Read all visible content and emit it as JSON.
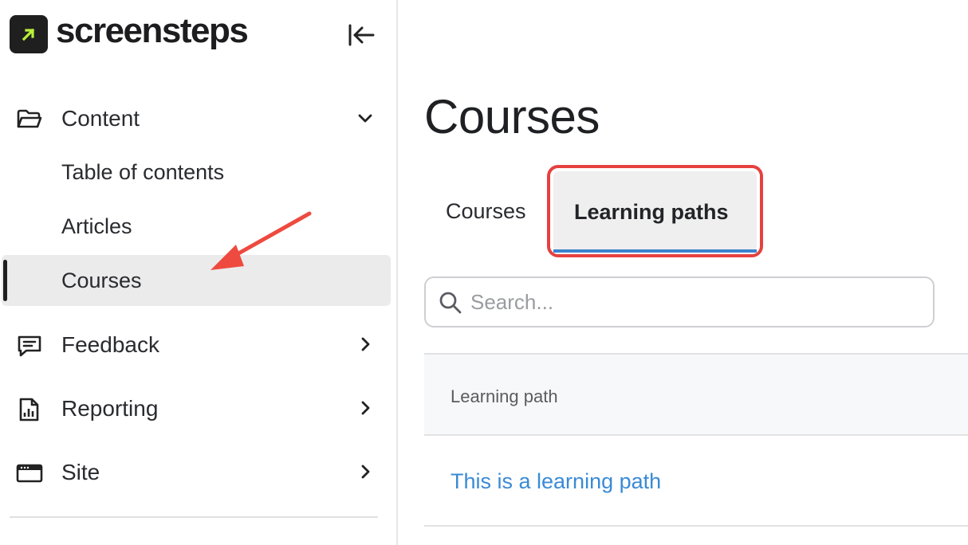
{
  "brand": {
    "name": "screensteps",
    "logo_color": "#1f1f1f",
    "logo_accent": "#b8f03a"
  },
  "sidebar": {
    "collapse_icon": "collapse-left-icon",
    "sections": [
      {
        "label": "Content",
        "icon": "folder-open-icon",
        "chevron": "chevron-down-icon"
      },
      {
        "label": "Feedback",
        "icon": "message-icon",
        "chevron": "chevron-right-icon"
      },
      {
        "label": "Reporting",
        "icon": "report-file-icon",
        "chevron": "chevron-right-icon"
      },
      {
        "label": "Site",
        "icon": "browser-window-icon",
        "chevron": "chevron-right-icon"
      }
    ],
    "content_items": [
      {
        "label": "Table of contents"
      },
      {
        "label": "Articles"
      },
      {
        "label": "Courses",
        "active": true
      }
    ]
  },
  "main": {
    "title": "Courses",
    "tabs": [
      {
        "label": "Courses"
      },
      {
        "label": "Learning paths",
        "selected": true
      }
    ],
    "search": {
      "placeholder": "Search...",
      "value": ""
    },
    "table": {
      "columns": [
        "Learning path"
      ],
      "rows": [
        {
          "name": "This is a learning path"
        }
      ]
    }
  },
  "colors": {
    "highlight_border": "#e5413f",
    "tab_underline": "#3a82cf",
    "link": "#3a8ad6",
    "annotation_arrow": "#ee4a3f"
  }
}
